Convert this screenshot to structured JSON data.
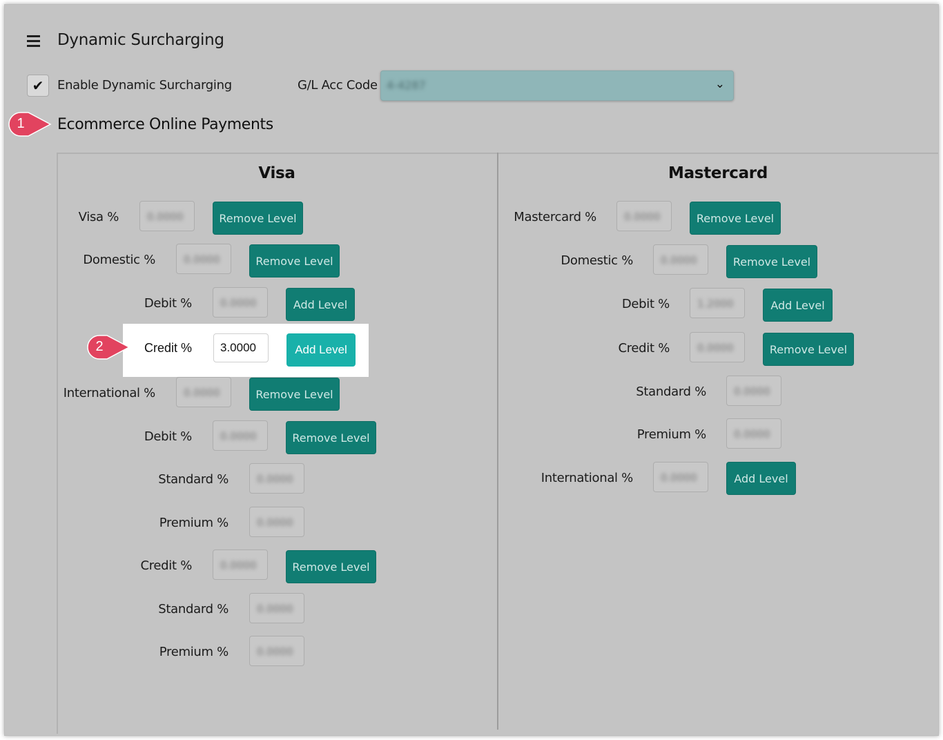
{
  "header": {
    "title": "Dynamic Surcharging",
    "menu_icon": "hamburger-icon"
  },
  "settings": {
    "enable_label": "Enable Dynamic Surcharging",
    "enable_checked": true,
    "gl_label": "G/L Acc Code",
    "gl_value": "4-4287"
  },
  "section": {
    "title": "Ecommerce Online Payments"
  },
  "callouts": [
    "1",
    "2"
  ],
  "visa": {
    "title": "Visa",
    "rows": [
      {
        "label": "Visa %",
        "value": "0.0000",
        "button": "Remove Level"
      },
      {
        "label": "Domestic %",
        "value": "0.0000",
        "button": "Remove Level"
      },
      {
        "label": "Debit %",
        "value": "0.0000",
        "button": "Add Level"
      },
      {
        "label": "Credit %",
        "value": "3.0000",
        "button": "Add Level"
      },
      {
        "label": "International %",
        "value": "0.0000",
        "button": "Remove Level"
      },
      {
        "label": "Debit %",
        "value": "0.0000",
        "button": "Remove Level"
      },
      {
        "label": "Standard %",
        "value": "0.0000",
        "button": ""
      },
      {
        "label": "Premium %",
        "value": "0.0000",
        "button": ""
      },
      {
        "label": "Credit %",
        "value": "0.0000",
        "button": "Remove Level"
      },
      {
        "label": "Standard %",
        "value": "0.0000",
        "button": ""
      },
      {
        "label": "Premium %",
        "value": "0.0000",
        "button": ""
      }
    ]
  },
  "mastercard": {
    "title": "Mastercard",
    "rows": [
      {
        "label": "Mastercard %",
        "value": "0.0000",
        "button": "Remove Level"
      },
      {
        "label": "Domestic %",
        "value": "0.0000",
        "button": "Remove Level"
      },
      {
        "label": "Debit %",
        "value": "1.2000",
        "button": "Add Level"
      },
      {
        "label": "Credit %",
        "value": "0.0000",
        "button": "Remove Level"
      },
      {
        "label": "Standard %",
        "value": "0.0000",
        "button": ""
      },
      {
        "label": "Premium %",
        "value": "0.0000",
        "button": ""
      },
      {
        "label": "International %",
        "value": "0.0000",
        "button": "Add Level"
      }
    ]
  },
  "colors": {
    "button_dim": "#117d73",
    "button_highlight": "#19b1aa",
    "callout": "#e2435f",
    "overlay_gray": "#c4c4c4"
  }
}
